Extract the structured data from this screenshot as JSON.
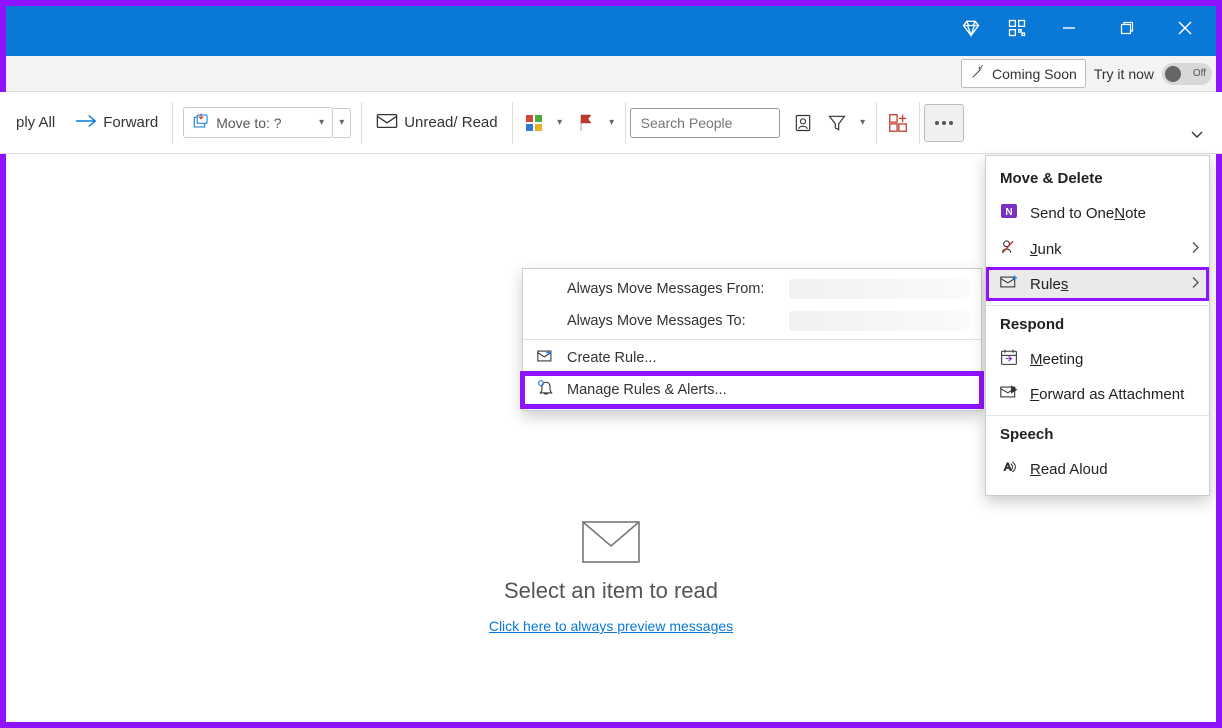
{
  "titlebar": {},
  "strip": {
    "coming_soon": "Coming Soon",
    "try_it_now": "Try it now",
    "toggle_label": "Off"
  },
  "ribbon": {
    "reply_all": "ply All",
    "forward": "Forward",
    "move_to": "Move to: ?",
    "unread_read": "Unread/ Read",
    "search_placeholder": "Search People"
  },
  "overflow": {
    "sections": {
      "move_delete": "Move & Delete",
      "respond": "Respond",
      "speech": "Speech"
    },
    "items": {
      "onenote_pre": "Send to One",
      "onenote_u": "N",
      "onenote_post": "ote",
      "junk_u": "J",
      "junk_post": "unk",
      "rules_pre": "Rule",
      "rules_u": "s",
      "meeting_u": "M",
      "meeting_post": "eeting",
      "fwd_u": "F",
      "fwd_post": "orward as Attachment",
      "read_u": "R",
      "read_post": "ead Aloud"
    }
  },
  "rules_submenu": {
    "always_from": "Always Move Messages From:",
    "always_to": "Always Move Messages To:",
    "create_rule_pre": "Create R",
    "create_rule_u": "u",
    "create_rule_post": "le...",
    "manage_pre": "Manage Ru",
    "manage_u": "l",
    "manage_post": "es & Alerts..."
  },
  "reading_pane": {
    "title": "Select an item to read",
    "link": "Click here to always preview messages"
  }
}
